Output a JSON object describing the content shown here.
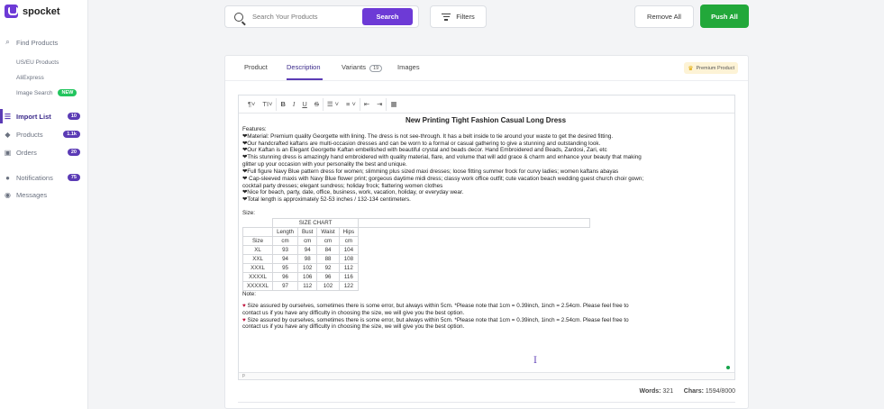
{
  "app": {
    "name": "spocket"
  },
  "sidebar": {
    "items": [
      {
        "label": "Find Products",
        "icon": "search-icon",
        "type": "main"
      },
      {
        "label": "US/EU Products",
        "type": "sub"
      },
      {
        "label": "AliExpress",
        "type": "sub"
      },
      {
        "label": "Image Search",
        "type": "sub",
        "badge": "NEW"
      },
      {
        "label": "Import List",
        "icon": "list-icon",
        "type": "main",
        "badge": "10",
        "active": true
      },
      {
        "label": "Products",
        "icon": "tag-icon",
        "type": "main",
        "badge": "1.1k"
      },
      {
        "label": "Orders",
        "icon": "cart-icon",
        "type": "main",
        "badge": "20"
      },
      {
        "label": "Notifications",
        "icon": "bell-icon",
        "type": "main",
        "badge": "75"
      },
      {
        "label": "Messages",
        "icon": "chat-icon",
        "type": "main"
      }
    ]
  },
  "topbar": {
    "search_placeholder": "Search Your Products",
    "search_button": "Search",
    "filters_button": "Filters",
    "remove_all": "Remove All",
    "push_all": "Push All"
  },
  "tabs": [
    {
      "label": "Product"
    },
    {
      "label": "Description",
      "active": true
    },
    {
      "label": "Variants",
      "count": "19"
    },
    {
      "label": "Images"
    }
  ],
  "premium_label": "Premium Product",
  "editor": {
    "toolbar": [
      "¶",
      "TI",
      "B",
      "I",
      "U",
      "S"
    ],
    "title": "New Printing Tight Fashion Casual Long Dress",
    "features_label": "Features:",
    "features": [
      "❤Material: Premium quality Georgette with lining. The dress is not see-through. It has a belt inside to tie around your waste to get the desired fitting.",
      "❤Our handcrafted kaftans are multi-occasion dresses and can be worn to a formal or casual gathering to give a stunning and outstanding look.",
      "❤Our Kaftan is an Elegant Georgette Kaftan embellished with beautiful crystal and beads decor. Hand Embroidered and  Beads, Zardosi, Zari, etc",
      "❤This stunning dress is amazingly hand embroidered with quality material, flare, and volume that will add grace & charm and enhance your beauty that making",
      "glitter up your occasion with your personality the best and unique.",
      "❤Full figure Navy Blue pattern dress for women; slimming plus sized maxi dresses; loose fitting summer frock for curvy ladies; women kaftans abayas",
      "❤ Cap-sleeved maxis with Navy Blue flower print; gorgeous daytime midi dress; classy work office outfit; cute vacation beach wedding guest church choir gown;",
      "cocktail party dresses; elegant sundress; holiday frock; flattering women clothes",
      "❤Nice for beach, party, date, office, business, work, vacation, holiday, or everyday wear.",
      "❤Total length is approximately 52-53 inches / 132-134 centimeters."
    ],
    "size_label": "Size:",
    "size_chart_title": "SIZE CHART",
    "size_headers": [
      "",
      "Length",
      "Bust",
      "Waist",
      "Hips"
    ],
    "size_units": [
      "Size",
      "cm",
      "cm",
      "cm",
      "cm"
    ],
    "size_rows": [
      [
        "XL",
        "93",
        "94",
        "84",
        "104"
      ],
      [
        "XXL",
        "94",
        "98",
        "88",
        "108"
      ],
      [
        "XXXL",
        "95",
        "102",
        "92",
        "112"
      ],
      [
        "XXXXL",
        "96",
        "106",
        "96",
        "116"
      ],
      [
        "XXXXXL",
        "97",
        "112",
        "102",
        "122"
      ]
    ],
    "note_label": "Note:",
    "notes": [
      "Size assured by ourselves, sometimes there is some error, but always within 5cm. *Please note that 1cm = 0.39inch, 1inch =            2.54cm. Please feel free to",
      "contact us if you have any difficulty in choosing the size, we will give you the best option.",
      "Size assured by ourselves, sometimes there is some error, but always within 5cm. *Please note that 1cm = 0.39inch, 1inch =            2.54cm. Please feel free to",
      "contact us if you have any difficulty in choosing the size, we will give you the best option."
    ],
    "status_path": "p"
  },
  "counts": {
    "words_label": "Words:",
    "words": "321",
    "chars_label": "Chars:",
    "chars": "1594/8000"
  }
}
